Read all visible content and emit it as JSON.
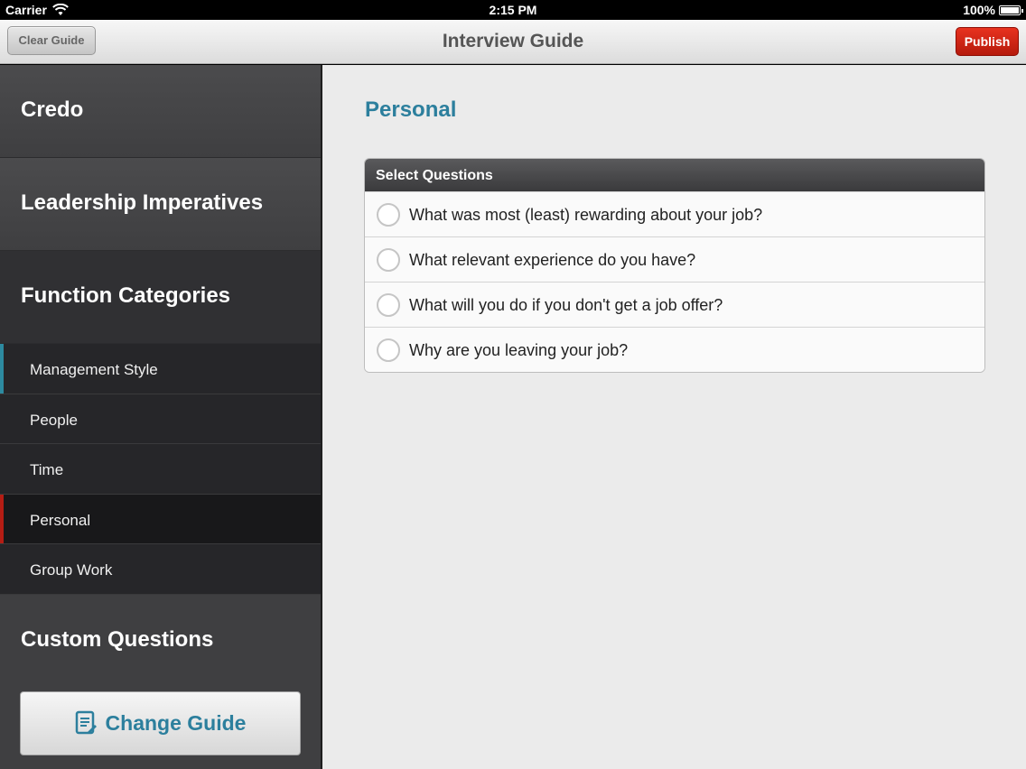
{
  "status_bar": {
    "carrier": "Carrier",
    "time": "2:15 PM",
    "battery": "100%"
  },
  "nav_bar": {
    "title": "Interview Guide",
    "clear_label": "Clear Guide",
    "publish_label": "Publish"
  },
  "sidebar": {
    "credo": "Credo",
    "leadership": "Leadership Imperatives",
    "function_categories": "Function Categories",
    "items": [
      {
        "label": "Management Style"
      },
      {
        "label": "People"
      },
      {
        "label": "Time"
      },
      {
        "label": "Personal"
      },
      {
        "label": "Group Work"
      }
    ],
    "custom_questions": "Custom Questions",
    "change_guide_label": "Change Guide"
  },
  "main": {
    "heading": "Personal",
    "select_header": "Select Questions",
    "questions": [
      "What was most (least) rewarding about your job?",
      "What relevant experience do you have?",
      "What will you do if you don't get a job offer?",
      "Why are you leaving your job?"
    ]
  },
  "colors": {
    "accent": "#2c7f9d",
    "publish": "#d0281a",
    "selected_marker": "#b51d14"
  }
}
